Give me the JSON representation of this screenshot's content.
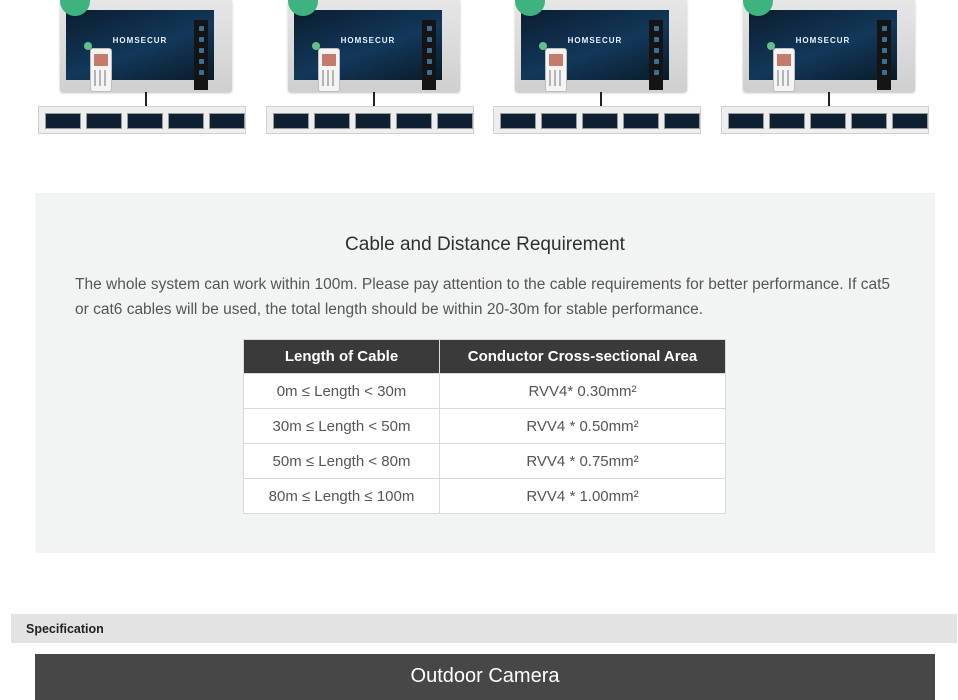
{
  "product_strip": {
    "brand": "HOMSECUR",
    "units": [
      {
        "brand": "HOMSECUR"
      },
      {
        "brand": "HOMSECUR"
      },
      {
        "brand": "HOMSECUR"
      },
      {
        "brand": "HOMSECUR"
      }
    ]
  },
  "cable_section": {
    "title": "Cable and Distance Requirement",
    "description": "The whole system can work within 100m. Please pay attention to the cable requirements for better performance. If cat5 or cat6 cables will be used, the total length should be within 20-30m for stable performance.",
    "table": {
      "headers": [
        "Length of Cable",
        "Conductor Cross-sectional Area"
      ],
      "rows": [
        [
          "0m ≤ Length < 30m",
          "RVV4* 0.30mm²"
        ],
        [
          "30m ≤ Length < 50m",
          "RVV4 * 0.50mm²"
        ],
        [
          "50m ≤ Length < 80m",
          "RVV4 * 0.75mm²"
        ],
        [
          "80m ≤ Length ≤ 100m",
          "RVV4 * 1.00mm²"
        ]
      ]
    }
  },
  "specification": {
    "label": "Specification"
  },
  "camera_section": {
    "title": "Outdoor Camera"
  },
  "icons": {
    "wifi": "wifi-icon",
    "phone": "smartphone-icon"
  },
  "colors": {
    "table_header": "#3a3a3a",
    "section_bg": "#f2f4f4",
    "camera_header": "#474747",
    "wifi_badge": "#3fb37f"
  }
}
